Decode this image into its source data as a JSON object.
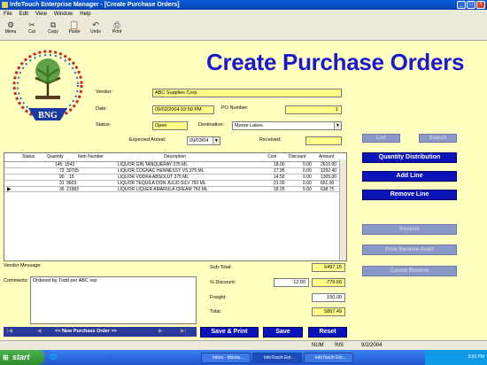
{
  "window": {
    "title": "InfoTouch Enterprise Manager - [Create Purchase Orders]"
  },
  "menu": [
    "File",
    "Edit",
    "View",
    "Window",
    "Help"
  ],
  "toolbar": [
    {
      "label": "Menu",
      "icon": "menu-icon"
    },
    {
      "label": "Cut",
      "icon": "scissors-icon"
    },
    {
      "label": "Copy",
      "icon": "copy-icon"
    },
    {
      "label": "Paste",
      "icon": "paste-icon"
    },
    {
      "label": "Undo",
      "icon": "undo-icon"
    },
    {
      "label": "Print",
      "icon": "printer-icon"
    }
  ],
  "logo_text": "BNG",
  "page_title": "Create Purchase Orders",
  "form": {
    "vendor_label": "Vendor:",
    "vendor": "ABC Supplies Corp",
    "date_label": "Date:",
    "date": "09/02/2004 03:50 PM",
    "po_label": "PO Number:",
    "po_number": "1",
    "status_label": "Status:",
    "status": "Open",
    "destination_label": "Destination:",
    "destination": "Moore Lakes",
    "expected_label": "Expected Arrival:",
    "expected": "09/03/04",
    "received_label": "Received:",
    "received": ""
  },
  "buttons": {
    "list": "List",
    "search": "Search",
    "qty_dist": "Quantity Distribution",
    "add_line": "Add Line",
    "remove_line": "Remove Line",
    "receive": "Receive",
    "print_receive_audit": "Print Receive Audit",
    "cancel_receive": "Cancel Receive",
    "save_print": "Save & Print",
    "save": "Save",
    "reset": "Reset",
    "new_po": "<< New Purchase Order >>",
    "nav_first": "|◀",
    "nav_prev": "◀",
    "nav_next": "▶",
    "nav_last": "▶|"
  },
  "grid": {
    "headers": [
      "Status",
      "Quantity",
      "Item Number",
      "Description",
      "Cost",
      "Discount",
      "Amount"
    ],
    "rows": [
      {
        "qty": "145",
        "item": "1543",
        "desc": "LIQUOR GIN   TANQUERAY      375 ML",
        "cost": "18.00",
        "disc": "0.00",
        "amount": "2610.00"
      },
      {
        "qty": "72",
        "item": "30705",
        "desc": "LIQUOR COGNAC HENNESSY VS    375 ML",
        "cost": "17.95",
        "disc": "0.00",
        "amount": "1292.40"
      },
      {
        "qty": "90",
        "item": "15",
        "desc": "LIQUOR VODKA  ABSOLUT       375 ML",
        "cost": "14.50",
        "disc": "0.00",
        "amount": "1305.00"
      },
      {
        "qty": "31",
        "item": "9603",
        "desc": "LIQUOR TEQUILA DON JULIO SILV 750 ML",
        "cost": "21.00",
        "disc": "0.00",
        "amount": "651.00"
      },
      {
        "qty": "35",
        "item": "21983",
        "desc": "LIQUOR LIQUER  AMARULA CREAM  750 ML",
        "cost": "18.25",
        "disc": "0.00",
        "amount": "638.75"
      }
    ]
  },
  "footer": {
    "vendor_msg_label": "Vendor Message:",
    "comments_label": "Comments:",
    "comments": "Ordered by Todd per ABC rep",
    "subtotal_label": "Sub-Total:",
    "subtotal": "6497.15",
    "discount_label": "% Discount:",
    "discount_pct": "12.00",
    "discount_amt": "-779.66",
    "freight_label": "Freight:",
    "freight": "150.00",
    "total_label": "Total:",
    "total": "5867.49"
  },
  "statusbar": {
    "num": "NUM",
    "ins": "INS",
    "date": "9/2/2004"
  },
  "taskbar": {
    "start": "start",
    "tasks": [
      "Inbox - Micros...",
      "InfoTouch Ent...",
      "InfoTouch Ent..."
    ],
    "clock": "3:50 PM"
  },
  "colors": {
    "form_bg": "#ffffc0",
    "title_blue": "#1a1acc",
    "button_blue": "#0a14b8",
    "field_yellow": "#ffff88"
  }
}
